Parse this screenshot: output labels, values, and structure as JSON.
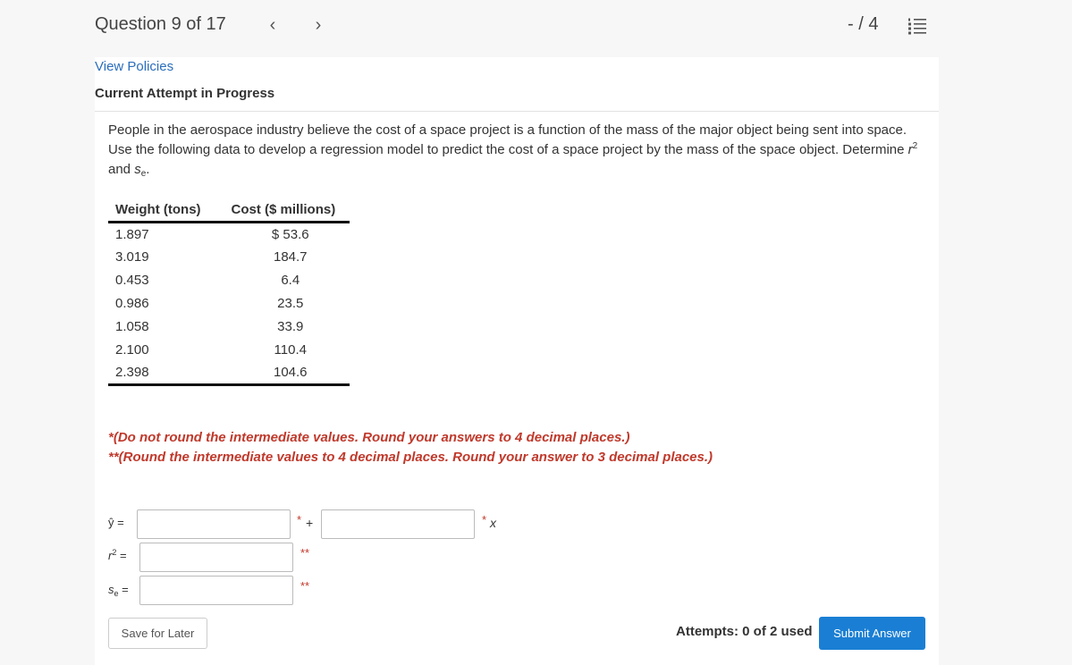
{
  "header": {
    "question_position": "Question 9 of 17",
    "prev_icon": "‹",
    "next_icon": "›",
    "score": "- / 4",
    "list_icon": "list-numbered-icon"
  },
  "links": {
    "view_policies": "View Policies"
  },
  "attempt_heading": "Current Attempt in Progress",
  "question": {
    "text_part1": "People in the aerospace industry believe the cost of a space project is a function of the mass of the major object being sent into space. Use the following data to develop a regression model to predict the cost of a space project by the mass of the space object. Determine ",
    "r_symbol": "r",
    "r_exp": "2",
    "and_text": " and ",
    "s_symbol": "s",
    "s_sub": "e",
    "end": "."
  },
  "table": {
    "headers": [
      "Weight (tons)",
      "Cost ($ millions)"
    ],
    "rows": [
      [
        "1.897",
        "$ 53.6"
      ],
      [
        "3.019",
        "184.7"
      ],
      [
        "0.453",
        "6.4"
      ],
      [
        "0.986",
        "23.5"
      ],
      [
        "1.058",
        "33.9"
      ],
      [
        "2.100",
        "110.4"
      ],
      [
        "2.398",
        "104.6"
      ]
    ]
  },
  "notes": {
    "note1": "*(Do not round the intermediate values. Round your answers to 4 decimal places.)",
    "note2": "**(Round the intermediate values to 4 decimal places. Round your answer to 3 decimal places.)"
  },
  "answers": {
    "yhat_label": "ŷ =",
    "r2_label_r": "r",
    "r2_label_exp": "2",
    "r2_label_eq": " =",
    "se_label_s": "s",
    "se_label_sub": "e",
    "se_label_eq": " =",
    "intercept_value": "",
    "slope_value": "",
    "r2_value": "",
    "se_value": "",
    "star1": "*",
    "plus": "+",
    "star2": "*",
    "x_var": "x",
    "star_r2": "**",
    "star_se": "**"
  },
  "footer": {
    "save_label": "Save for Later",
    "attempts": "Attempts: 0 of 2 used",
    "submit_label": "Submit Answer"
  },
  "colors": {
    "link": "#2a6ebb",
    "note": "#c0392b",
    "submit": "#1a7fd4"
  }
}
